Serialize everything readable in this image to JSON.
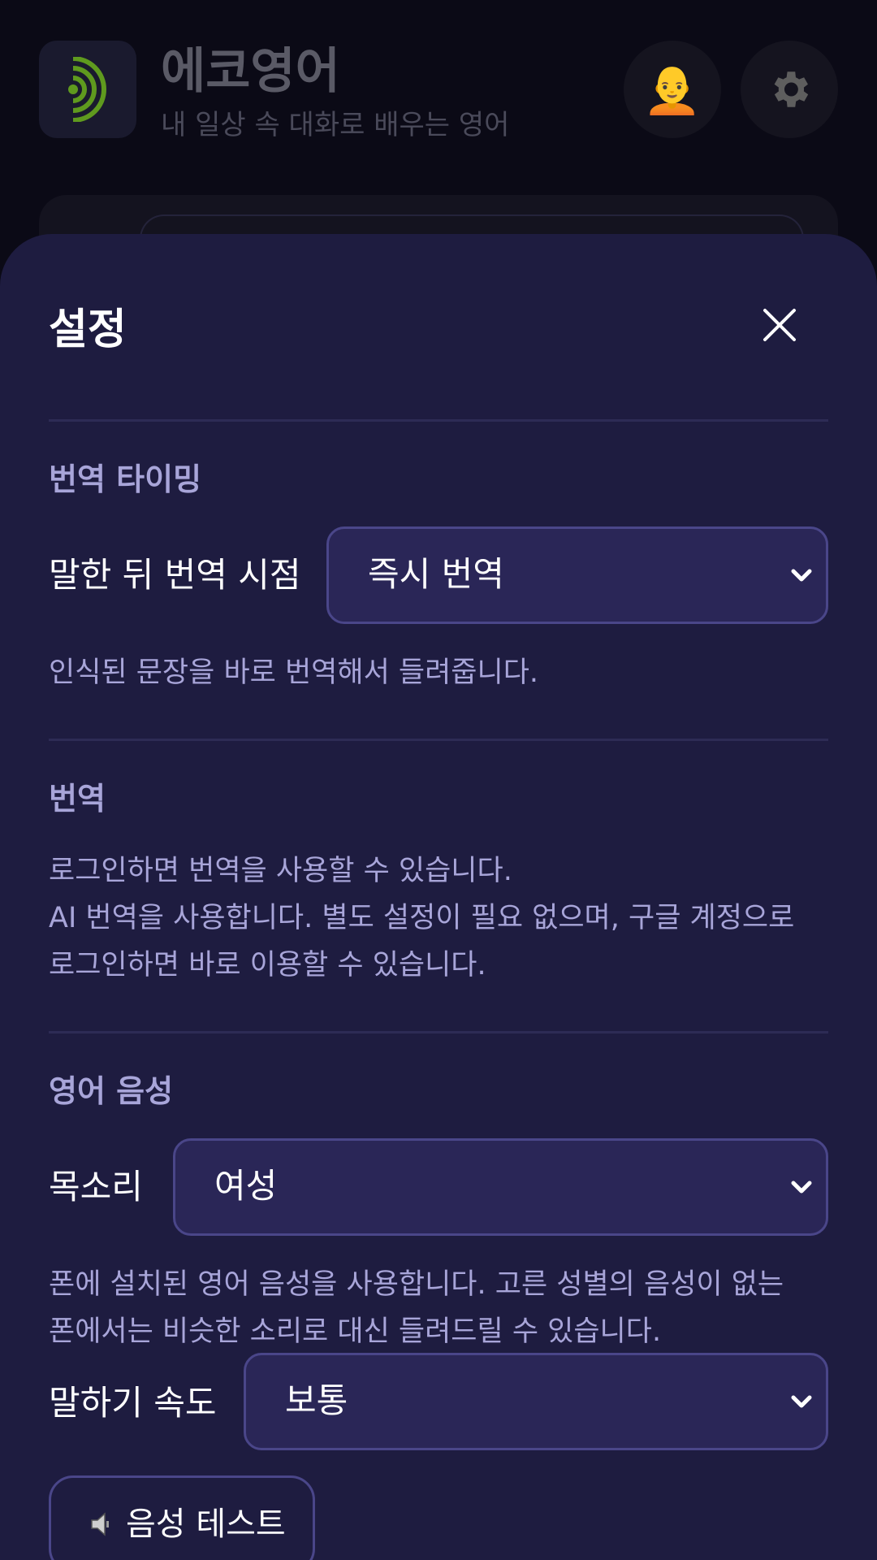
{
  "app": {
    "title": "에코영어",
    "subtitle": "내 일상 속 대화로 배우는 영어",
    "profile_icon": "🧑‍🦲",
    "settings_icon": "⚙"
  },
  "settings": {
    "title": "설정",
    "translation_timing": {
      "section_label": "번역 타이밍",
      "row_label": "말한 뒤 번역 시점",
      "selected": "즉시 번역",
      "help": "인식된 문장을 바로 번역해서 들려줍니다."
    },
    "translation": {
      "section_label": "번역",
      "help_lines": [
        "로그인하면 번역을 사용할 수 있습니다.",
        "AI 번역을 사용합니다. 별도 설정이 필요 없으며, 구글 계정으로",
        "로그인하면 바로 이용할 수 있습니다."
      ]
    },
    "voice": {
      "section_label": "영어 음성",
      "voice_label": "목소리",
      "voice_selected": "여성",
      "help_lines": [
        "폰에 설치된 영어 음성을 사용합니다. 고른 성별의 음성이 없는",
        "폰에서는 비슷한 소리로 대신 들려드릴 수 있습니다."
      ],
      "speed_label": "말하기 속도",
      "speed_selected": "보통",
      "test_button": "음성 테스트"
    }
  },
  "colors": {
    "sheet_bg": "#1e1c40",
    "select_bg": "#2a2657",
    "muted_text": "#a8a5d9",
    "logo_accent": "#5f9a1e"
  }
}
